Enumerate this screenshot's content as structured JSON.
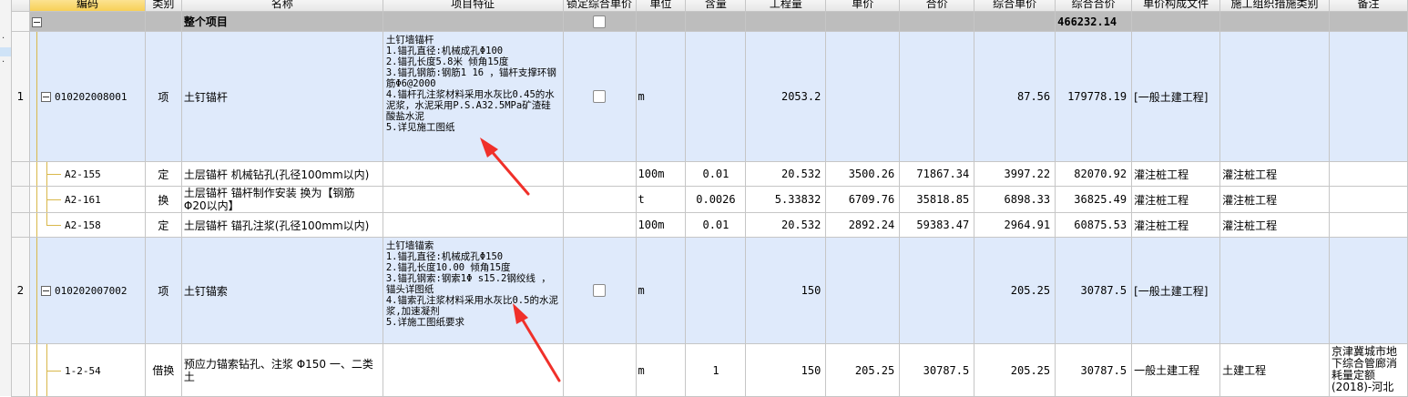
{
  "headers": [
    "编码",
    "类别",
    "名称",
    "项目特征",
    "锁定综合单价",
    "单位",
    "含量",
    "工程量",
    "单价",
    "合价",
    "综合单价",
    "综合合价",
    "单价构成文件",
    "施工组织措施类别",
    "备注"
  ],
  "total_row": {
    "code": "",
    "name": "整个项目",
    "total": "466232.14"
  },
  "rows": [
    {
      "kind": "item",
      "idx": "1",
      "code": "010202008001",
      "type": "项",
      "name": "土钉锚杆",
      "features": [
        "土钉墙锚杆",
        "1.锚孔直径:机械成孔Φ100",
        "2.锚孔长度5.8米 倾角15度",
        "3.锚孔钢筋:钢筋1 16 ，锚杆支撑环钢筋Φ6@2000",
        "4.锚杆孔注浆材料采用水灰比0.45的水泥浆，水泥采用P.S.A32.5MPa矿渣硅酸盐水泥",
        "5.详见施工图纸"
      ],
      "unit": "m",
      "content": "",
      "qty": "2053.2",
      "price": "",
      "amount": "",
      "unit_price": "87.56",
      "total_price": "179778.19",
      "file": "[一般土建工程]",
      "category": "",
      "note": ""
    },
    {
      "kind": "sub",
      "code": "A2-155",
      "type": "定",
      "name": "土层锚杆 机械钻孔(孔径100mm以内)",
      "unit": "100m",
      "content": "0.01",
      "qty": "20.532",
      "price": "3500.26",
      "amount": "71867.34",
      "unit_price": "3997.22",
      "total_price": "82070.92",
      "file": "灌注桩工程",
      "category": "灌注桩工程",
      "note": ""
    },
    {
      "kind": "sub",
      "code": "A2-161",
      "type": "换",
      "name": "土层锚杆 锚杆制作安装  换为【钢筋 Φ20以内】",
      "unit": "t",
      "content": "0.0026",
      "qty": "5.33832",
      "price": "6709.76",
      "amount": "35818.85",
      "unit_price": "6898.33",
      "total_price": "36825.49",
      "file": "灌注桩工程",
      "category": "灌注桩工程",
      "note": ""
    },
    {
      "kind": "sub",
      "code": "A2-158",
      "type": "定",
      "name": "土层锚杆 锚孔注浆(孔径100mm以内)",
      "unit": "100m",
      "content": "0.01",
      "qty": "20.532",
      "price": "2892.24",
      "amount": "59383.47",
      "unit_price": "2964.91",
      "total_price": "60875.53",
      "file": "灌注桩工程",
      "category": "灌注桩工程",
      "note": ""
    },
    {
      "kind": "item",
      "idx": "2",
      "code": "010202007002",
      "type": "项",
      "name": "土钉锚索",
      "features": [
        "土钉墙锚索",
        "1.锚孔直径:机械成孔Φ150",
        "2.锚孔长度10.00 倾角15度",
        "3.锚孔钢索:钢索1Φ s15.2钢绞线 ，锚头详图纸",
        "4.锚索孔注浆材料采用水灰比0.5的水泥浆,加速凝剂",
        "5.详施工图纸要求"
      ],
      "unit": "m",
      "content": "",
      "qty": "150",
      "price": "",
      "amount": "",
      "unit_price": "205.25",
      "total_price": "30787.5",
      "file": "[一般土建工程]",
      "category": "",
      "note": ""
    },
    {
      "kind": "sub",
      "code": "1-2-54",
      "type": "借换",
      "name": "预应力锚索钻孔、注浆 Φ150 一、二类土",
      "unit": "m",
      "content": "1",
      "qty": "150",
      "price": "205.25",
      "amount": "30787.5",
      "unit_price": "205.25",
      "total_price": "30787.5",
      "file": "一般土建工程",
      "category": "土建工程",
      "note": "京津冀城市地下综合管廊消耗量定额(2018)-河北"
    }
  ]
}
